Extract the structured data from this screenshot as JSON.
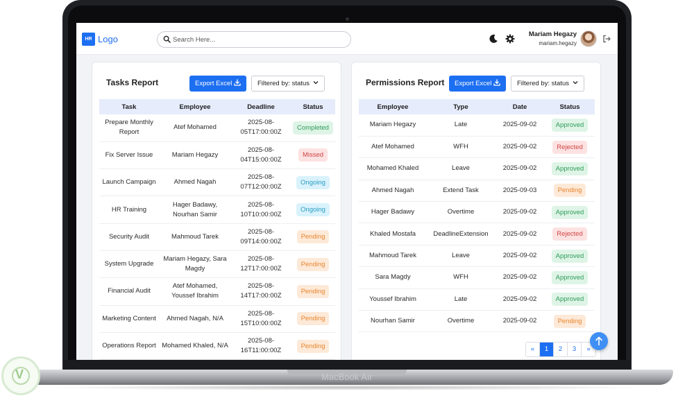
{
  "device": {
    "label": "MacBook Air"
  },
  "nav": {
    "logo_badge": "HR",
    "logo_text": "Logo",
    "search_placeholder": "Search Here...",
    "user_name": "Mariam Hegazy",
    "user_email": "mariam.hegazy",
    "icons": [
      "moon-icon",
      "gear-icon",
      "avatar",
      "logout-icon",
      "search-icon"
    ]
  },
  "tasks_report": {
    "title": "Tasks Report",
    "export_label": "Export Excel",
    "filter_label": "Filtered by: status",
    "columns": [
      "Task",
      "Employee",
      "Deadline",
      "Status"
    ],
    "rows": [
      {
        "task": "Prepare Monthly Report",
        "employee": "Atef Mohamed",
        "deadline": "2025-08-05T17:00:00Z",
        "status": "Completed"
      },
      {
        "task": "Fix Server Issue",
        "employee": "Mariam Hegazy",
        "deadline": "2025-08-04T15:00:00Z",
        "status": "Missed"
      },
      {
        "task": "Launch Campaign",
        "employee": "Ahmed Nagah",
        "deadline": "2025-08-07T12:00:00Z",
        "status": "Ongoing"
      },
      {
        "task": "HR Training",
        "employee": "Hager Badawy, Nourhan Samir",
        "deadline": "2025-08-10T10:00:00Z",
        "status": "Ongoing"
      },
      {
        "task": "Security Audit",
        "employee": "Mahmoud Tarek",
        "deadline": "2025-08-09T14:00:00Z",
        "status": "Pending"
      },
      {
        "task": "System Upgrade",
        "employee": "Mariam Hegazy, Sara Magdy",
        "deadline": "2025-08-12T17:00:00Z",
        "status": "Pending"
      },
      {
        "task": "Financial Audit",
        "employee": "Atef Mohamed, Youssef Ibrahim",
        "deadline": "2025-08-14T17:00:00Z",
        "status": "Pending"
      },
      {
        "task": "Marketing Content",
        "employee": "Ahmed Nagah, N/A",
        "deadline": "2025-08-15T10:00:00Z",
        "status": "Pending"
      },
      {
        "task": "Operations Report",
        "employee": "Mohamed Khaled, N/A",
        "deadline": "2025-08-16T11:00:00Z",
        "status": "Pending"
      }
    ]
  },
  "permissions_report": {
    "title": "Permissions Report",
    "export_label": "Export Excel",
    "filter_label": "Filtered by: status",
    "columns": [
      "Employee",
      "Type",
      "Date",
      "Status"
    ],
    "rows": [
      {
        "employee": "Mariam Hegazy",
        "type": "Late",
        "date": "2025-09-02",
        "status": "Approved"
      },
      {
        "employee": "Atef Mohamed",
        "type": "WFH",
        "date": "2025-09-02",
        "status": "Rejected"
      },
      {
        "employee": "Mohamed Khaled",
        "type": "Leave",
        "date": "2025-09-02",
        "status": "Approved"
      },
      {
        "employee": "Ahmed Nagah",
        "type": "Extend Task",
        "date": "2025-09-03",
        "status": "Pending"
      },
      {
        "employee": "Hager Badawy",
        "type": "Overtime",
        "date": "2025-09-02",
        "status": "Approved"
      },
      {
        "employee": "Khaled Mostafa",
        "type": "DeadlineExtension",
        "date": "2025-09-02",
        "status": "Rejected"
      },
      {
        "employee": "Mahmoud Tarek",
        "type": "Leave",
        "date": "2025-09-02",
        "status": "Approved"
      },
      {
        "employee": "Sara Magdy",
        "type": "WFH",
        "date": "2025-09-02",
        "status": "Approved"
      },
      {
        "employee": "Youssef Ibrahim",
        "type": "Late",
        "date": "2025-09-02",
        "status": "Approved"
      },
      {
        "employee": "Nourhan Samir",
        "type": "Overtime",
        "date": "2025-09-02",
        "status": "Pending"
      }
    ],
    "pagination": {
      "prev": "«",
      "pages": [
        "1",
        "2",
        "3"
      ],
      "active": "1",
      "next": "»"
    }
  },
  "colors": {
    "primary": "#1d6ff2",
    "approved": "#2f9d5a",
    "rejected": "#d14343",
    "ongoing": "#2a9dc3",
    "pending": "#e8862e",
    "header_bg": "#e6ecfb"
  }
}
